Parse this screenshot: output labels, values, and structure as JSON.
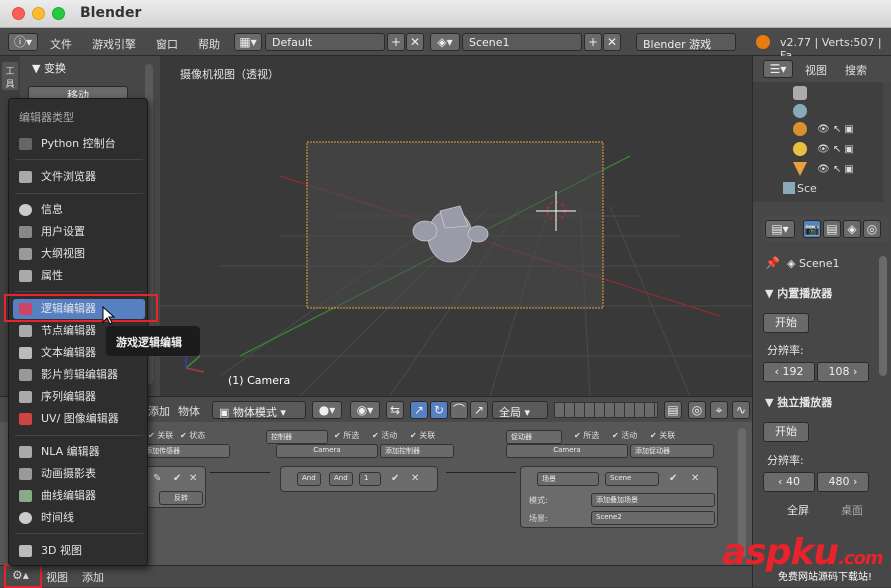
{
  "window": {
    "title": "Blender"
  },
  "info_header": {
    "menus": [
      "文件",
      "游戏引擎",
      "窗口",
      "帮助"
    ],
    "layout": "Default",
    "scene": "Scene1",
    "engine": "Blender 游戏",
    "stats": "v2.77 | Verts:507 | Fa"
  },
  "toolshelf": {
    "panel_title": "变换",
    "first_button": "移动",
    "tab_label": "工具"
  },
  "viewport": {
    "title": "摄像机视图（透视）",
    "object_label": "(1) Camera"
  },
  "dropdown": {
    "title": "编辑器类型",
    "groups": [
      [
        {
          "label": "Python 控制台",
          "icon": "python-console-icon"
        },
        {
          "label": "文件浏览器",
          "icon": "file-browser-icon"
        }
      ],
      [
        {
          "label": "信息",
          "icon": "info-icon"
        },
        {
          "label": "用户设置",
          "icon": "user-prefs-icon"
        },
        {
          "label": "大纲视图",
          "icon": "outliner-icon"
        },
        {
          "label": "属性",
          "icon": "properties-icon"
        }
      ],
      [
        {
          "label": "逻辑编辑器",
          "icon": "logic-editor-icon"
        },
        {
          "label": "节点编辑器",
          "icon": "node-editor-icon"
        },
        {
          "label": "文本编辑器",
          "icon": "text-editor-icon"
        },
        {
          "label": "影片剪辑编辑器",
          "icon": "clip-editor-icon"
        },
        {
          "label": "序列编辑器",
          "icon": "sequencer-icon"
        },
        {
          "label": "UV/ 图像编辑器",
          "icon": "uv-image-icon"
        }
      ],
      [
        {
          "label": "NLA 编辑器",
          "icon": "nla-icon"
        },
        {
          "label": "动画摄影表",
          "icon": "dopesheet-icon"
        },
        {
          "label": "曲线编辑器",
          "icon": "graph-editor-icon"
        },
        {
          "label": "时间线",
          "icon": "timeline-icon"
        }
      ],
      [
        {
          "label": "3D 视图",
          "icon": "view3d-icon"
        }
      ]
    ],
    "tooltip": "游戏逻辑编辑"
  },
  "logic_header": {
    "menu_add": "添加",
    "menu_object": "物体",
    "mode": "物体模式",
    "global": "全局"
  },
  "logic": {
    "sensors_header": "添加传感器",
    "controllers_dropdown": "控制器",
    "controllers_object": "Camera",
    "controllers_add": "添加控制器",
    "actuators_dropdown": "促动器",
    "actuators_object": "Camera",
    "actuators_add": "添加促动器",
    "checkbox_labels": [
      "关联",
      "状态",
      "所选",
      "活动",
      "关联",
      "所选",
      "活动",
      "关联"
    ],
    "and_label": "And",
    "and_btn": "And",
    "and_num": "1",
    "invert_label": "反转",
    "actuator_type": "场景",
    "actuator_scene": "Scene",
    "mode_label": "模式:",
    "mode_value": "添加叠加场景",
    "scene_label": "场景:",
    "scene_value": "Scene2"
  },
  "bottom_header": {
    "menu_view": "视图",
    "menu_add": "添加"
  },
  "right_panel": {
    "outliner_tabs": [
      "视图",
      "搜索"
    ],
    "outliner_item": "Sce",
    "scene_name": "Scene1",
    "embedded_player": "内置播放器",
    "start_btn": "开始",
    "resolution_label": "分辨率:",
    "embedded_res": [
      "192",
      "108"
    ],
    "standalone_player": "独立播放器",
    "start_btn2": "开始",
    "resolution_label2": "分辨率:",
    "standalone_res": [
      "40",
      "480"
    ],
    "fullscreen": "全屏",
    "desktop": "桌面"
  },
  "watermark": {
    "brand": "aspku",
    "tld": ".com",
    "sub": "免费网站源码下载站!"
  },
  "colors": {
    "highlight": "#5680c2",
    "red": "#e8232b",
    "camera_frame": "#e8a03c"
  }
}
